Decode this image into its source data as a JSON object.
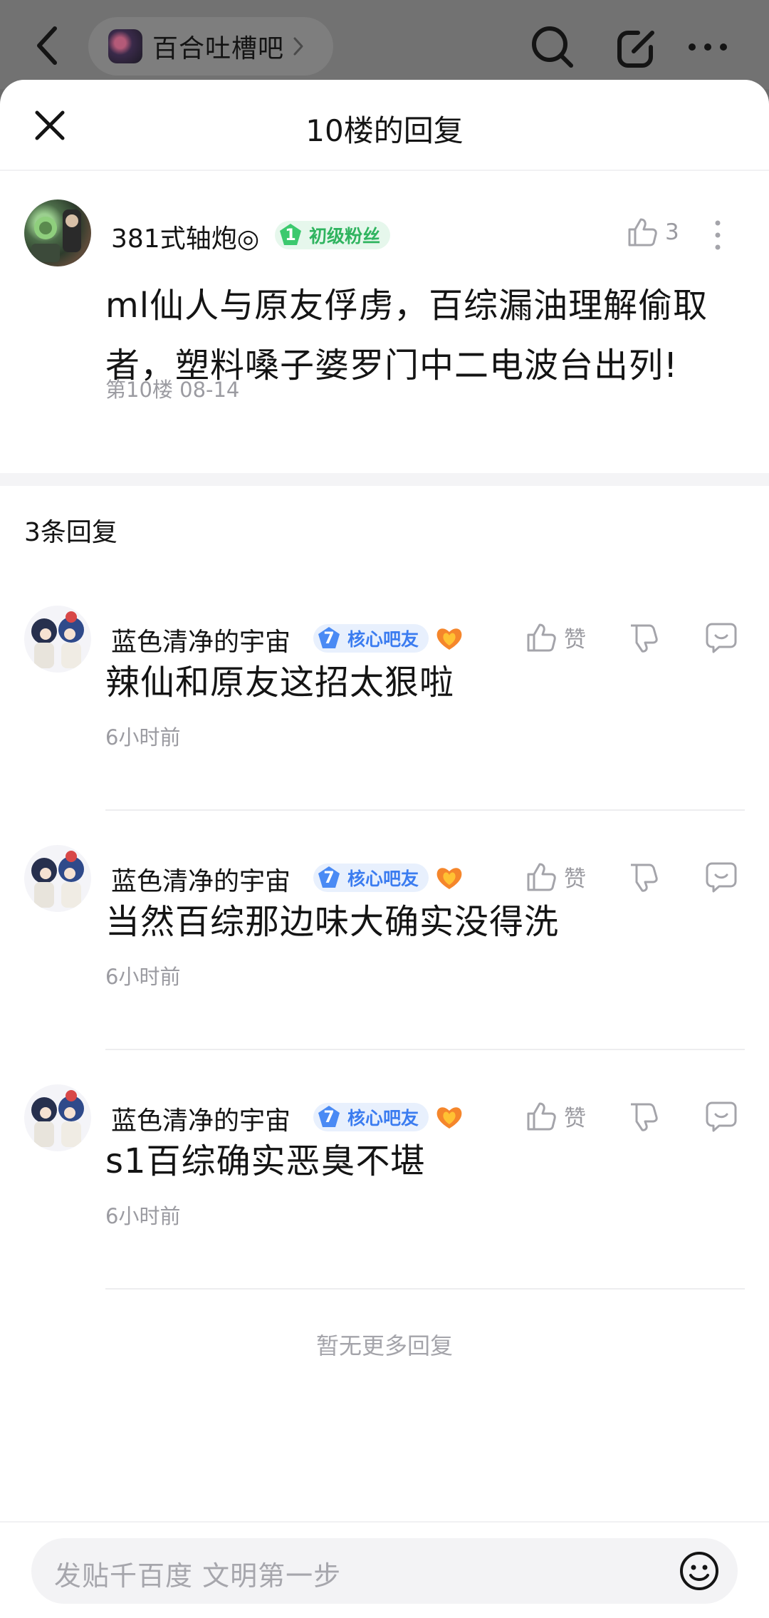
{
  "topbar": {
    "forum_name": "百合吐槽吧"
  },
  "sheet": {
    "title": "10楼的回复"
  },
  "op": {
    "username": "381式轴炮◎",
    "badge_level": "1",
    "badge_label": "初级粉丝",
    "like_count": "3",
    "content": "ml仙人与原友俘虏，百综漏油理解偷取者，塑料嗓子婆罗门中二电波台出列!",
    "meta": "第10楼  08-14"
  },
  "replies_header": "3条回复",
  "replies": [
    {
      "username": "蓝色清净的宇宙",
      "badge_level": "7",
      "badge_label": "核心吧友",
      "like_label": "赞",
      "content": "辣仙和原友这招太狠啦",
      "time": "6小时前"
    },
    {
      "username": "蓝色清净的宇宙",
      "badge_level": "7",
      "badge_label": "核心吧友",
      "like_label": "赞",
      "content": "当然百综那边味大确实没得洗",
      "time": "6小时前"
    },
    {
      "username": "蓝色清净的宇宙",
      "badge_level": "7",
      "badge_label": "核心吧友",
      "like_label": "赞",
      "content": "s1百综确实恶臭不堪",
      "time": "6小时前"
    }
  ],
  "no_more": "暂无更多回复",
  "input": {
    "placeholder": "发贴千百度 文明第一步"
  },
  "colors": {
    "badge_green": "#2fb45f",
    "badge_blue": "#3b7cf0",
    "muted_text": "#9b9ba1"
  }
}
